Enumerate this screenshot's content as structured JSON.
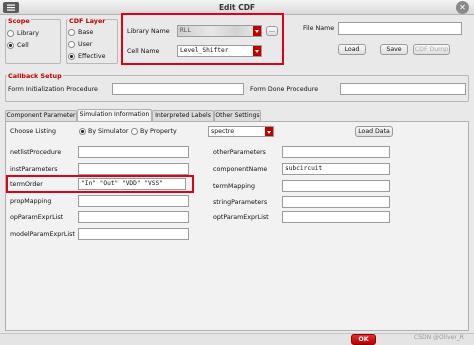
{
  "window": {
    "title": "Edit CDF"
  },
  "scope": {
    "title": "Scope",
    "options": [
      {
        "label": "Library",
        "selected": false
      },
      {
        "label": "Cell",
        "selected": true
      }
    ]
  },
  "cdf_layer": {
    "title": "CDF Layer",
    "options": [
      {
        "label": "Base",
        "selected": false
      },
      {
        "label": "User",
        "selected": false
      },
      {
        "label": "Effective",
        "selected": true
      }
    ]
  },
  "cell_select": {
    "library_label": "Library Name",
    "library_value": "RLL",
    "browse_label": "...",
    "cell_label": "Cell Name",
    "cell_value": "Level_Shifter"
  },
  "file": {
    "label": "File Name",
    "value": "",
    "load_label": "Load",
    "save_label": "Save",
    "dump_label": "CDF Dump"
  },
  "callback": {
    "title": "Callback Setup",
    "init_label": "Form Initialization Procedure",
    "init_value": "",
    "done_label": "Form Done Procedure",
    "done_value": ""
  },
  "tabs": [
    {
      "label": "Component Parameter",
      "active": false
    },
    {
      "label": "Simulation Information",
      "active": true
    },
    {
      "label": "Interpreted Labels",
      "active": false
    },
    {
      "label": "Other Settings",
      "active": false
    }
  ],
  "sim": {
    "choose_label": "Choose Listing",
    "by_simulator": "By Simulator",
    "by_property": "By Property",
    "simulator": "spectre",
    "load_data": "Load Data",
    "left_fields": [
      {
        "label": "netlistProcedure",
        "value": ""
      },
      {
        "label": "instParameters",
        "value": ""
      },
      {
        "label": "termOrder",
        "value": "\"In\" \"Out\" \"VDD\" \"VSS\""
      },
      {
        "label": "propMapping",
        "value": ""
      },
      {
        "label": "opParamExprList",
        "value": ""
      },
      {
        "label": "modelParamExprList",
        "value": ""
      }
    ],
    "right_fields": [
      {
        "label": "otherParameters",
        "value": ""
      },
      {
        "label": "componentName",
        "value": "subcircuit"
      },
      {
        "label": "termMapping",
        "value": ""
      },
      {
        "label": "stringParameters",
        "value": ""
      },
      {
        "label": "optParamExprList",
        "value": ""
      }
    ]
  },
  "footer": {
    "ok_label": "OK",
    "watermark": "CSDN @Oliver_R"
  },
  "colors": {
    "accent_red": "#c00000",
    "highlight_red": "#e0001b"
  }
}
